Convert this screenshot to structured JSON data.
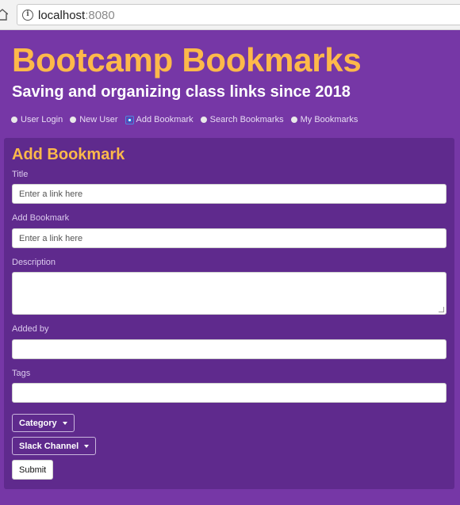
{
  "browser": {
    "url_host": "localhost",
    "url_port": ":8080"
  },
  "header": {
    "title": "Bootcamp Bookmarks",
    "subtitle": "Saving and organizing class links since 2018"
  },
  "nav": {
    "items": [
      {
        "label": "User Login",
        "active": false
      },
      {
        "label": "New User",
        "active": false
      },
      {
        "label": "Add Bookmark",
        "active": true
      },
      {
        "label": "Search Bookmarks",
        "active": false
      },
      {
        "label": "My Bookmarks",
        "active": false
      }
    ]
  },
  "form": {
    "title": "Add Bookmark",
    "title_field": {
      "label": "Title",
      "placeholder": "Enter a link here",
      "value": ""
    },
    "bookmark_field": {
      "label": "Add Bookmark",
      "placeholder": "Enter a link here",
      "value": ""
    },
    "description_field": {
      "label": "Description",
      "value": ""
    },
    "added_by_field": {
      "label": "Added by",
      "value": ""
    },
    "tags_field": {
      "label": "Tags",
      "value": ""
    },
    "category_dropdown": "Category",
    "slack_dropdown": "Slack Channel",
    "submit_label": "Submit"
  },
  "colors": {
    "page_bg": "#7637a6",
    "card_bg": "#5f2a8d",
    "accent": "#fdb94a"
  }
}
